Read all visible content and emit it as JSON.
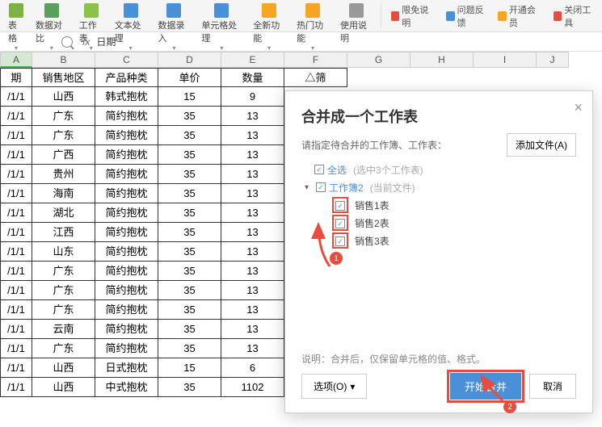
{
  "ribbon": {
    "items": [
      "表格",
      "数据对比",
      "工作表",
      "文本处理",
      "数据录入",
      "单元格处理",
      "全新功能",
      "热门功能",
      "使用说明"
    ],
    "links": [
      {
        "label": "限免说明",
        "color": "#e74c3c"
      },
      {
        "label": "问题反馈",
        "color": "#4a90d9"
      },
      {
        "label": "开通会员",
        "color": "#f5a623"
      },
      {
        "label": "关闭工具",
        "color": "#e74c3c"
      }
    ]
  },
  "formula_bar": {
    "fx": "fx",
    "content": "日期"
  },
  "columns": [
    "A",
    "B",
    "C",
    "D",
    "E",
    "F",
    "G",
    "H",
    "I",
    "J"
  ],
  "header_row": [
    "期",
    "销售地区",
    "产品种类",
    "单价",
    "数量",
    "△筛"
  ],
  "rows": [
    [
      "/1/1",
      "山西",
      "韩式抱枕",
      "15",
      "9"
    ],
    [
      "/1/1",
      "广东",
      "简约抱枕",
      "35",
      "13"
    ],
    [
      "/1/1",
      "广东",
      "简约抱枕",
      "35",
      "13"
    ],
    [
      "/1/1",
      "广西",
      "简约抱枕",
      "35",
      "13"
    ],
    [
      "/1/1",
      "贵州",
      "简约抱枕",
      "35",
      "13"
    ],
    [
      "/1/1",
      "海南",
      "简约抱枕",
      "35",
      "13"
    ],
    [
      "/1/1",
      "湖北",
      "简约抱枕",
      "35",
      "13"
    ],
    [
      "/1/1",
      "江西",
      "简约抱枕",
      "35",
      "13"
    ],
    [
      "/1/1",
      "山东",
      "简约抱枕",
      "35",
      "13"
    ],
    [
      "/1/1",
      "广东",
      "简约抱枕",
      "35",
      "13"
    ],
    [
      "/1/1",
      "广东",
      "简约抱枕",
      "35",
      "13"
    ],
    [
      "/1/1",
      "广东",
      "简约抱枕",
      "35",
      "13"
    ],
    [
      "/1/1",
      "云南",
      "简约抱枕",
      "35",
      "13"
    ],
    [
      "/1/1",
      "广东",
      "简约抱枕",
      "35",
      "13"
    ],
    [
      "/1/1",
      "山西",
      "日式抱枕",
      "15",
      "6"
    ],
    [
      "/1/1",
      "山西",
      "中式抱枕",
      "35",
      "1102"
    ]
  ],
  "dialog": {
    "title": "合并成一个工作表",
    "subtitle": "请指定待合并的工作簿、工作表：",
    "add_file": "添加文件(A)",
    "select_all": "全选",
    "select_all_hint": "(选中3个工作表)",
    "workbook": "工作簿2",
    "workbook_hint": "(当前文件)",
    "sheets": [
      "销售1表",
      "销售2表",
      "销售3表"
    ],
    "note": "说明：合并后，仅保留单元格的值、格式。",
    "options": "选项(O)",
    "start": "开始合并",
    "cancel": "取消"
  },
  "annotations": {
    "badge1": "1",
    "badge2": "2"
  }
}
